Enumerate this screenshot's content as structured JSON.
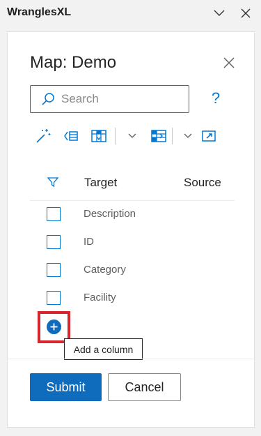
{
  "app": {
    "title": "WranglesXL"
  },
  "dialog": {
    "title": "Map: Demo",
    "search": {
      "placeholder": "Search",
      "value": ""
    },
    "help_label": "?",
    "toolbar": {
      "icons": [
        "magic-wand-icon",
        "list-add-icon",
        "table-import-icon",
        "dropdown-chevron-icon",
        "table-export-icon",
        "dropdown-chevron-icon",
        "open-external-icon"
      ]
    },
    "table": {
      "columns": [
        "Target",
        "Source"
      ],
      "rows": [
        {
          "label": "Description"
        },
        {
          "label": "ID"
        },
        {
          "label": "Category"
        },
        {
          "label": "Facility"
        }
      ]
    },
    "tooltip": "Add a column",
    "buttons": {
      "submit": "Submit",
      "cancel": "Cancel"
    }
  },
  "colors": {
    "accent": "#0f6cbd",
    "highlight": "#d7262e",
    "text": "#252423",
    "muted": "#605e5c"
  }
}
